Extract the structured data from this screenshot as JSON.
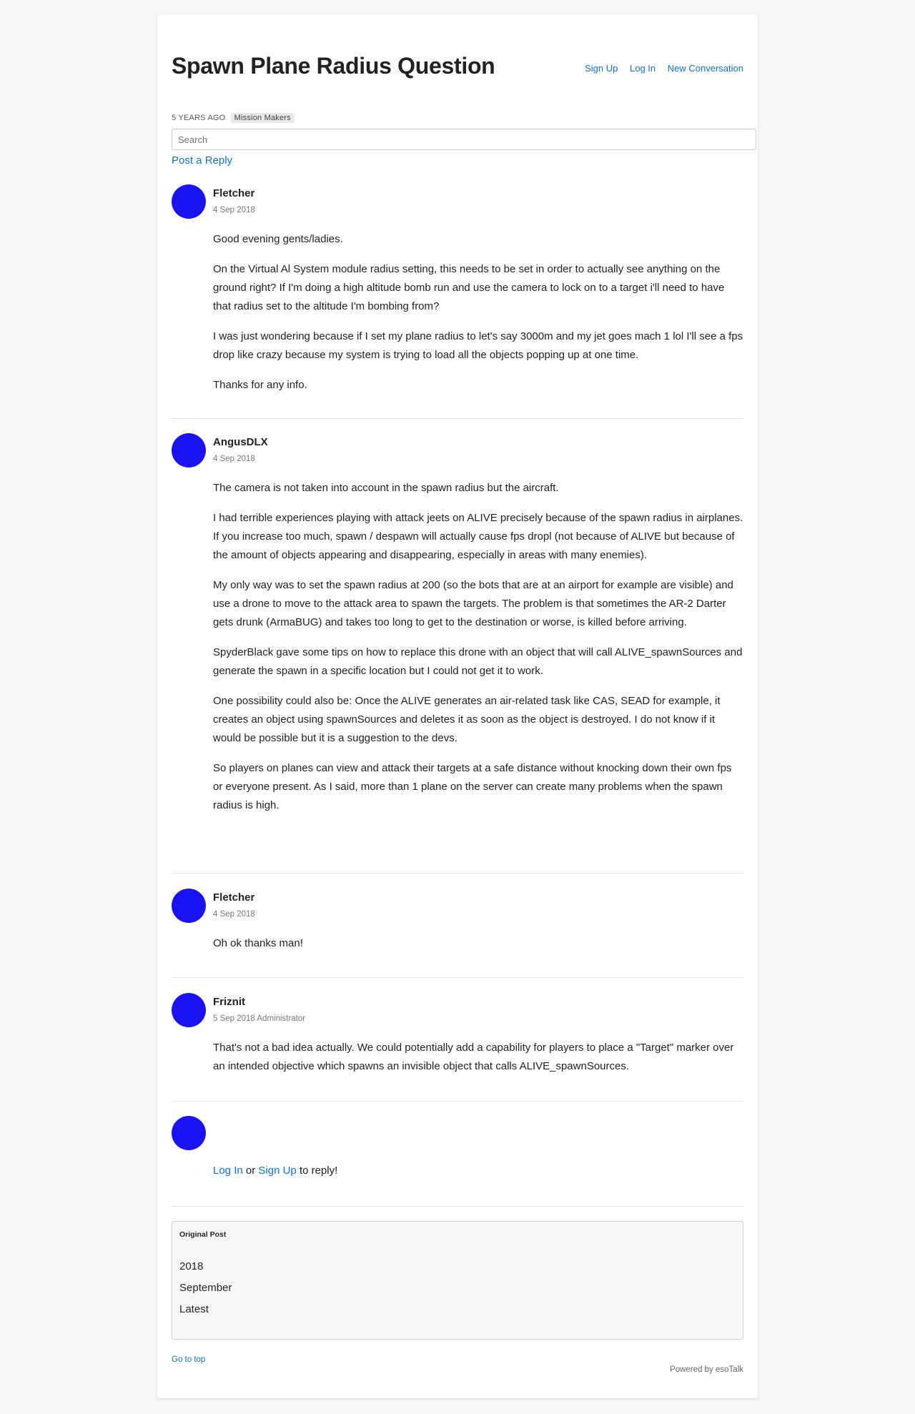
{
  "header": {
    "title": "Spawn Plane Radius Question",
    "nav": {
      "sign_up": "Sign Up",
      "log_in": "Log In",
      "new_conversation": "New Conversation"
    }
  },
  "meta": {
    "ago": "5 years ago",
    "channel": "Mission Makers"
  },
  "search": {
    "placeholder": "Search"
  },
  "post_reply_label": "Post a Reply",
  "posts": [
    {
      "author": "Fletcher",
      "date": "4 Sep 2018",
      "paragraphs": [
        "Good evening gents/ladies.",
        "On the Virtual Al System module radius setting, this needs to be set in order to actually see anything on the ground right? If I'm doing a high altitude bomb run and use the camera to lock on to a target i'll need to have that radius set to the altitude I'm bombing from?",
        "I was just wondering because if I set my plane radius to let's say 3000m and my jet goes mach 1 lol I'll see a fps drop like crazy because my system is trying to load all the objects popping up at one time.",
        "Thanks for any info."
      ]
    },
    {
      "author": "AngusDLX",
      "date": "4 Sep 2018",
      "paragraphs": [
        "The camera is not taken into account in the spawn radius but the aircraft.",
        "I had terrible experiences playing with attack jeets on ALIVE precisely because of the spawn radius in airplanes. If you increase too much, spawn / despawn will actually cause fps dropl (not because of ALIVE but because of the amount of objects appearing and disappearing, especially in areas with many enemies).",
        "My only way was to set the spawn radius at 200 (so the bots that are at an airport for example are visible) and use a drone to move to the attack area to spawn the targets. The problem is that sometimes the AR-2 Darter gets drunk (ArmaBUG) and takes too long to get to the destination or worse, is killed before arriving.",
        "SpyderBlack gave some tips on how to replace this drone with an object that will call ALIVE_spawnSources and generate the spawn in a specific location but I could not get it to work.",
        "One possibility could also be: Once the ALIVE generates an air-related task like CAS, SEAD for example, it creates an object using spawnSources and deletes it as soon as the object is destroyed. I do not know if it would be possible but it is a suggestion to the devs.",
        "So players on planes can view and attack their targets at a safe distance without knocking down their own fps or everyone present. As I said, more than 1 plane on the server can create many problems when the spawn radius is high."
      ]
    },
    {
      "author": "Fletcher",
      "date": "4 Sep 2018",
      "paragraphs": [
        "Oh ok thanks man!"
      ]
    },
    {
      "author": "Friznit",
      "date": "5 Sep 2018 Administrator",
      "paragraphs": [
        "That's not a bad idea actually. We could potentially add a capability for players to place a \"Target\" marker over an intended objective which spawns an invisible object that calls ALIVE_spawnSources."
      ]
    }
  ],
  "reply_prompt": {
    "log_in": "Log In",
    "or": "or",
    "sign_up": "Sign Up",
    "suffix": "to reply!"
  },
  "scrubber": {
    "heading": "Original Post",
    "items": [
      "2018",
      "September",
      "Latest"
    ]
  },
  "footer": {
    "go_to_top": "Go to top",
    "powered_by": "Powered by esoTalk"
  },
  "colors": {
    "avatar": "#1a12f0",
    "link": "#0b73d6"
  }
}
